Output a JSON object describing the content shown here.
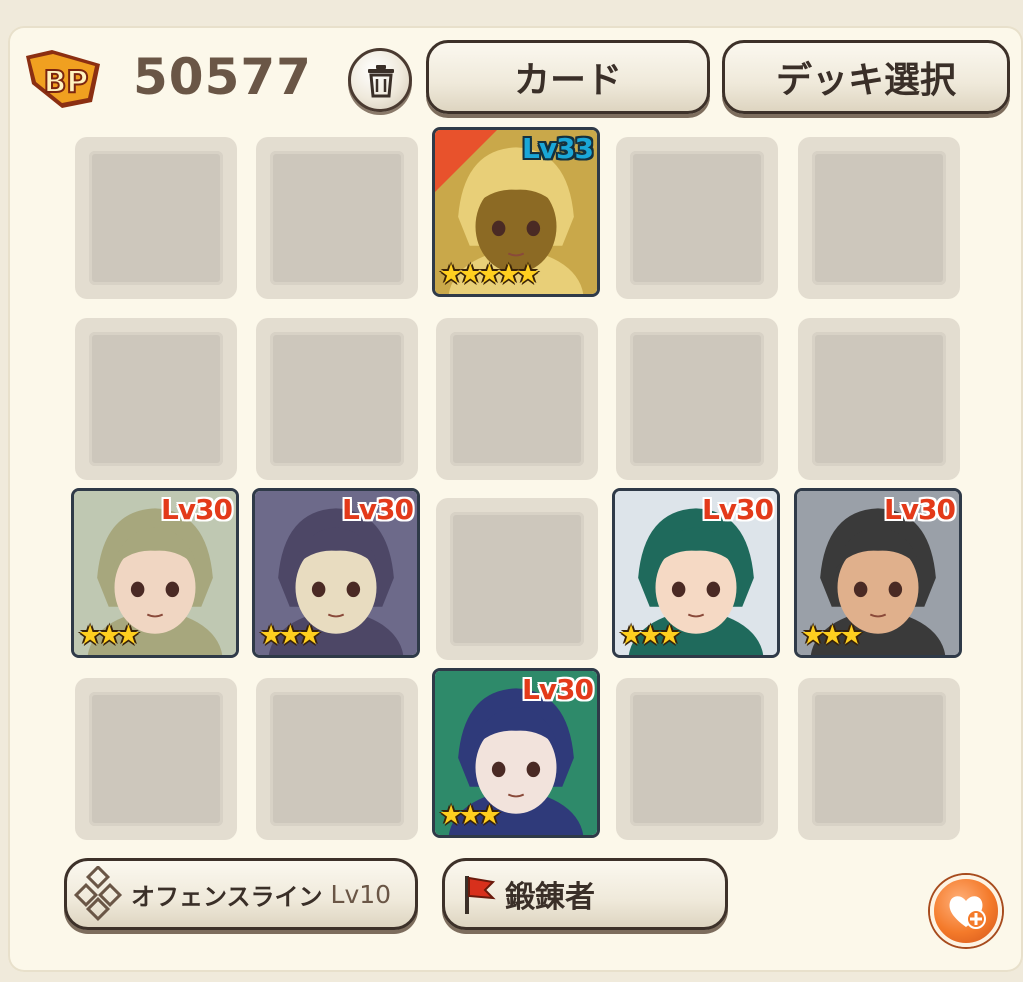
{
  "header": {
    "bp_label": "BP",
    "bp_value": "50577",
    "card_button": "カード",
    "deck_button": "デッキ選択"
  },
  "grid": {
    "rows": 4,
    "cols": 5,
    "cards": [
      {
        "row": 0,
        "col": 2,
        "level": "Lv33",
        "stars": "★★★★★",
        "leader": true,
        "level_color": "blue",
        "palette": [
          "#c9a84a",
          "#8c6a24",
          "#e8cf78"
        ]
      },
      {
        "row": 2,
        "col": 0,
        "level": "Lv30",
        "stars": "★★★",
        "leader": false,
        "level_color": "red",
        "palette": [
          "#bfc8b2",
          "#f0d6c2",
          "#a7a77d"
        ]
      },
      {
        "row": 2,
        "col": 1,
        "level": "Lv30",
        "stars": "★★★",
        "leader": false,
        "level_color": "red",
        "palette": [
          "#6d6a8a",
          "#e8dcc0",
          "#4d4766"
        ]
      },
      {
        "row": 2,
        "col": 3,
        "level": "Lv30",
        "stars": "★★★",
        "leader": false,
        "level_color": "red",
        "palette": [
          "#dde4ea",
          "#f5d9c4",
          "#1f6a5c"
        ]
      },
      {
        "row": 2,
        "col": 4,
        "level": "Lv30",
        "stars": "★★★",
        "leader": false,
        "level_color": "red",
        "palette": [
          "#9aa0a8",
          "#e0b08c",
          "#3a3a3a"
        ]
      },
      {
        "row": 3,
        "col": 2,
        "level": "Lv30",
        "stars": "★★★",
        "leader": false,
        "level_color": "red",
        "palette": [
          "#2e8a6a",
          "#f2e3dc",
          "#2f3a7a"
        ]
      }
    ]
  },
  "footer": {
    "offense_label": "オフェンスライン",
    "offense_level": "Lv10",
    "title_label": "鍛錬者"
  },
  "colors": {
    "level_red": "#e33a1a",
    "level_blue": "#1aa7d8",
    "accent_orange": "#f47a2a"
  },
  "icons": [
    "bp-badge-icon",
    "trash-icon",
    "formation-icon",
    "red-flag-icon",
    "heart-plus-icon"
  ]
}
